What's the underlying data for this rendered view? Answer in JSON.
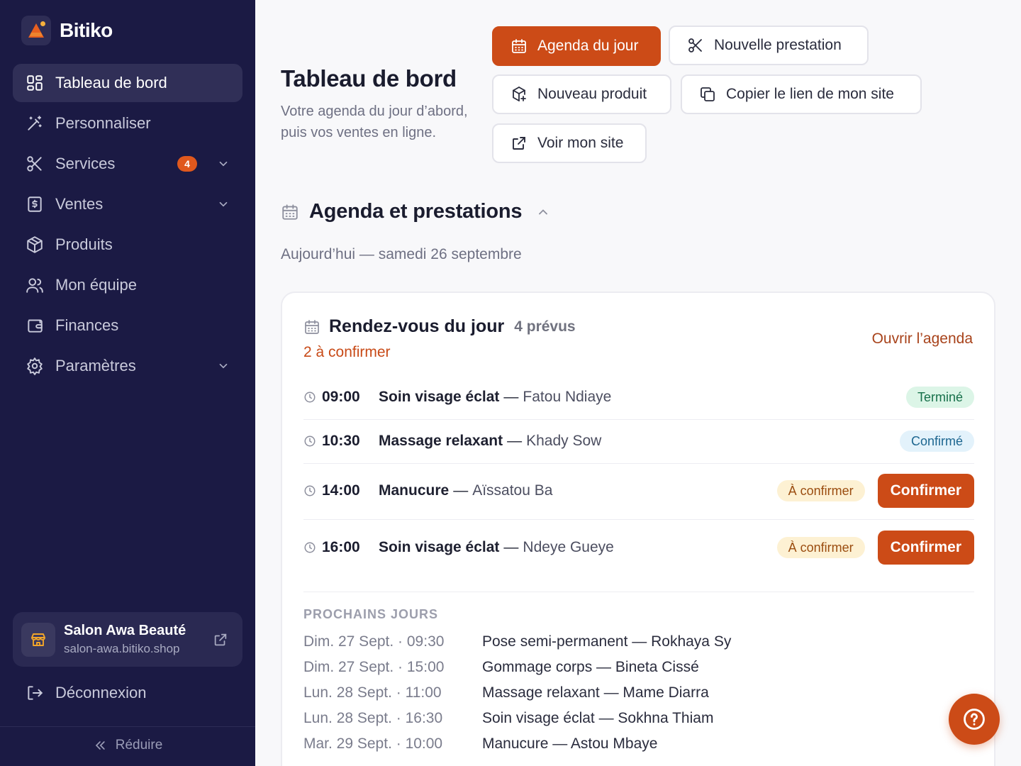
{
  "brand": {
    "name": "Bitiko"
  },
  "sidebar": {
    "items": [
      {
        "label": "Tableau de bord"
      },
      {
        "label": "Personnaliser"
      },
      {
        "label": "Services",
        "badge": "4"
      },
      {
        "label": "Ventes"
      },
      {
        "label": "Produits"
      },
      {
        "label": "Mon équipe"
      },
      {
        "label": "Finances"
      },
      {
        "label": "Paramètres"
      }
    ],
    "shop": {
      "name": "Salon Awa Beauté",
      "url": "salon-awa.bitiko.shop"
    },
    "logout_label": "Déconnexion",
    "collapse_label": "Réduire"
  },
  "header": {
    "title": "Tableau de bord",
    "subtitle": "Votre agenda du jour d’abord, puis vos ventes en ligne."
  },
  "actions": {
    "agenda_label": "Agenda du jour",
    "new_service_label": "Nouvelle prestation",
    "new_product_label": "Nouveau produit",
    "copy_link_label": "Copier le lien de mon site",
    "view_site_label": "Voir mon site"
  },
  "agenda_section": {
    "title": "Agenda et prestations",
    "date_line": "Aujourd’hui — samedi 26 septembre"
  },
  "today_card": {
    "title": "Rendez-vous du jour",
    "count": "4 prévus",
    "pending": "2 à confirmer",
    "open_label": "Ouvrir l’agenda",
    "appointments": [
      {
        "time": "09:00",
        "service": "Soin visage éclat",
        "client": "Fatou Ndiaye",
        "status": "Terminé"
      },
      {
        "time": "10:30",
        "service": "Massage relaxant",
        "client": "Khady Sow",
        "status": "Confirmé"
      },
      {
        "time": "14:00",
        "service": "Manucure",
        "client": "Aïssatou Ba",
        "status": "À confirmer",
        "action": "Confirmer"
      },
      {
        "time": "16:00",
        "service": "Soin visage éclat",
        "client": "Ndeye Gueye",
        "status": "À confirmer",
        "action": "Confirmer"
      }
    ],
    "separator": "—",
    "upcoming_title": "PROCHAINS JOURS",
    "upcoming": [
      {
        "when": "Dim. 27 Sept. · 09:30",
        "what": "Pose semi-permanent — Rokhaya Sy"
      },
      {
        "when": "Dim. 27 Sept. · 15:00",
        "what": "Gommage corps — Bineta Cissé"
      },
      {
        "when": "Lun. 28 Sept. · 11:00",
        "what": "Massage relaxant — Mame Diarra"
      },
      {
        "when": "Lun. 28 Sept. · 16:30",
        "what": "Soin visage éclat — Sokhna Thiam"
      },
      {
        "when": "Mar. 29 Sept. · 10:00",
        "what": "Manucure — Astou Mbaye"
      }
    ]
  },
  "colors": {
    "sidebar_bg": "#1b1a44",
    "accent": "#cc4b17",
    "badge": "#e0581d",
    "done_bg": "#dcf5e7",
    "confirmed_bg": "#e3f2fb",
    "pending_bg": "#fdf1d3"
  },
  "icons": {
    "brand": "logo-icon",
    "nav": [
      "dashboard-icon",
      "magic-wand-icon",
      "scissors-icon",
      "receipt-icon",
      "package-icon",
      "users-icon",
      "wallet-icon",
      "gear-icon"
    ],
    "help": "help-icon"
  }
}
